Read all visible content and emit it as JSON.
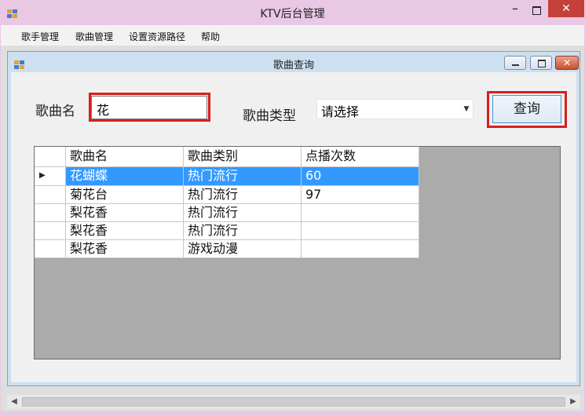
{
  "app": {
    "title": "KTV后台管理"
  },
  "menu": [
    "歌手管理",
    "歌曲管理",
    "设置资源路径",
    "帮助"
  ],
  "child": {
    "title": "歌曲查询"
  },
  "search": {
    "song_name_label": "歌曲名",
    "song_name_value": "花",
    "song_type_label": "歌曲类型",
    "song_type_value": "请选择",
    "query_button": "查询"
  },
  "grid": {
    "columns": [
      "歌曲名",
      "歌曲类别",
      "点播次数"
    ],
    "rows": [
      [
        "花蝴蝶",
        "热门流行",
        "60"
      ],
      [
        "菊花台",
        "热门流行",
        "97"
      ],
      [
        "梨花香",
        "热门流行",
        ""
      ],
      [
        "梨花香",
        "热门流行",
        ""
      ],
      [
        "梨花香",
        "游戏动漫",
        ""
      ]
    ],
    "selected_row": 0
  },
  "colors": {
    "highlight": "#d81e1e",
    "selection": "#3399ff"
  }
}
